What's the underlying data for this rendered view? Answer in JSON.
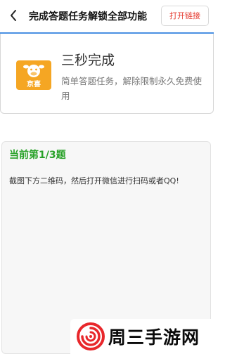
{
  "header": {
    "back_icon": "chevron-left-icon",
    "title": "完成答题任务解锁全部功能",
    "open_link_label": "打开链接",
    "accent_color": "#e53a2f",
    "divider_color": "#4a90e2"
  },
  "task": {
    "app_icon": "cow-icon",
    "app_icon_label": "京喜",
    "app_icon_color": "#f5a623",
    "name": "三秒完成",
    "description": "简单答题任务，解除限制永久免费使用"
  },
  "question": {
    "progress": "当前第1/3题",
    "progress_color": "#27a127",
    "instruction": "截图下方二维码，然后打开微信进行扫码或者QQ!"
  },
  "watermark": {
    "logo_icon": "swirl-logo-icon",
    "text": "周三手游网"
  }
}
